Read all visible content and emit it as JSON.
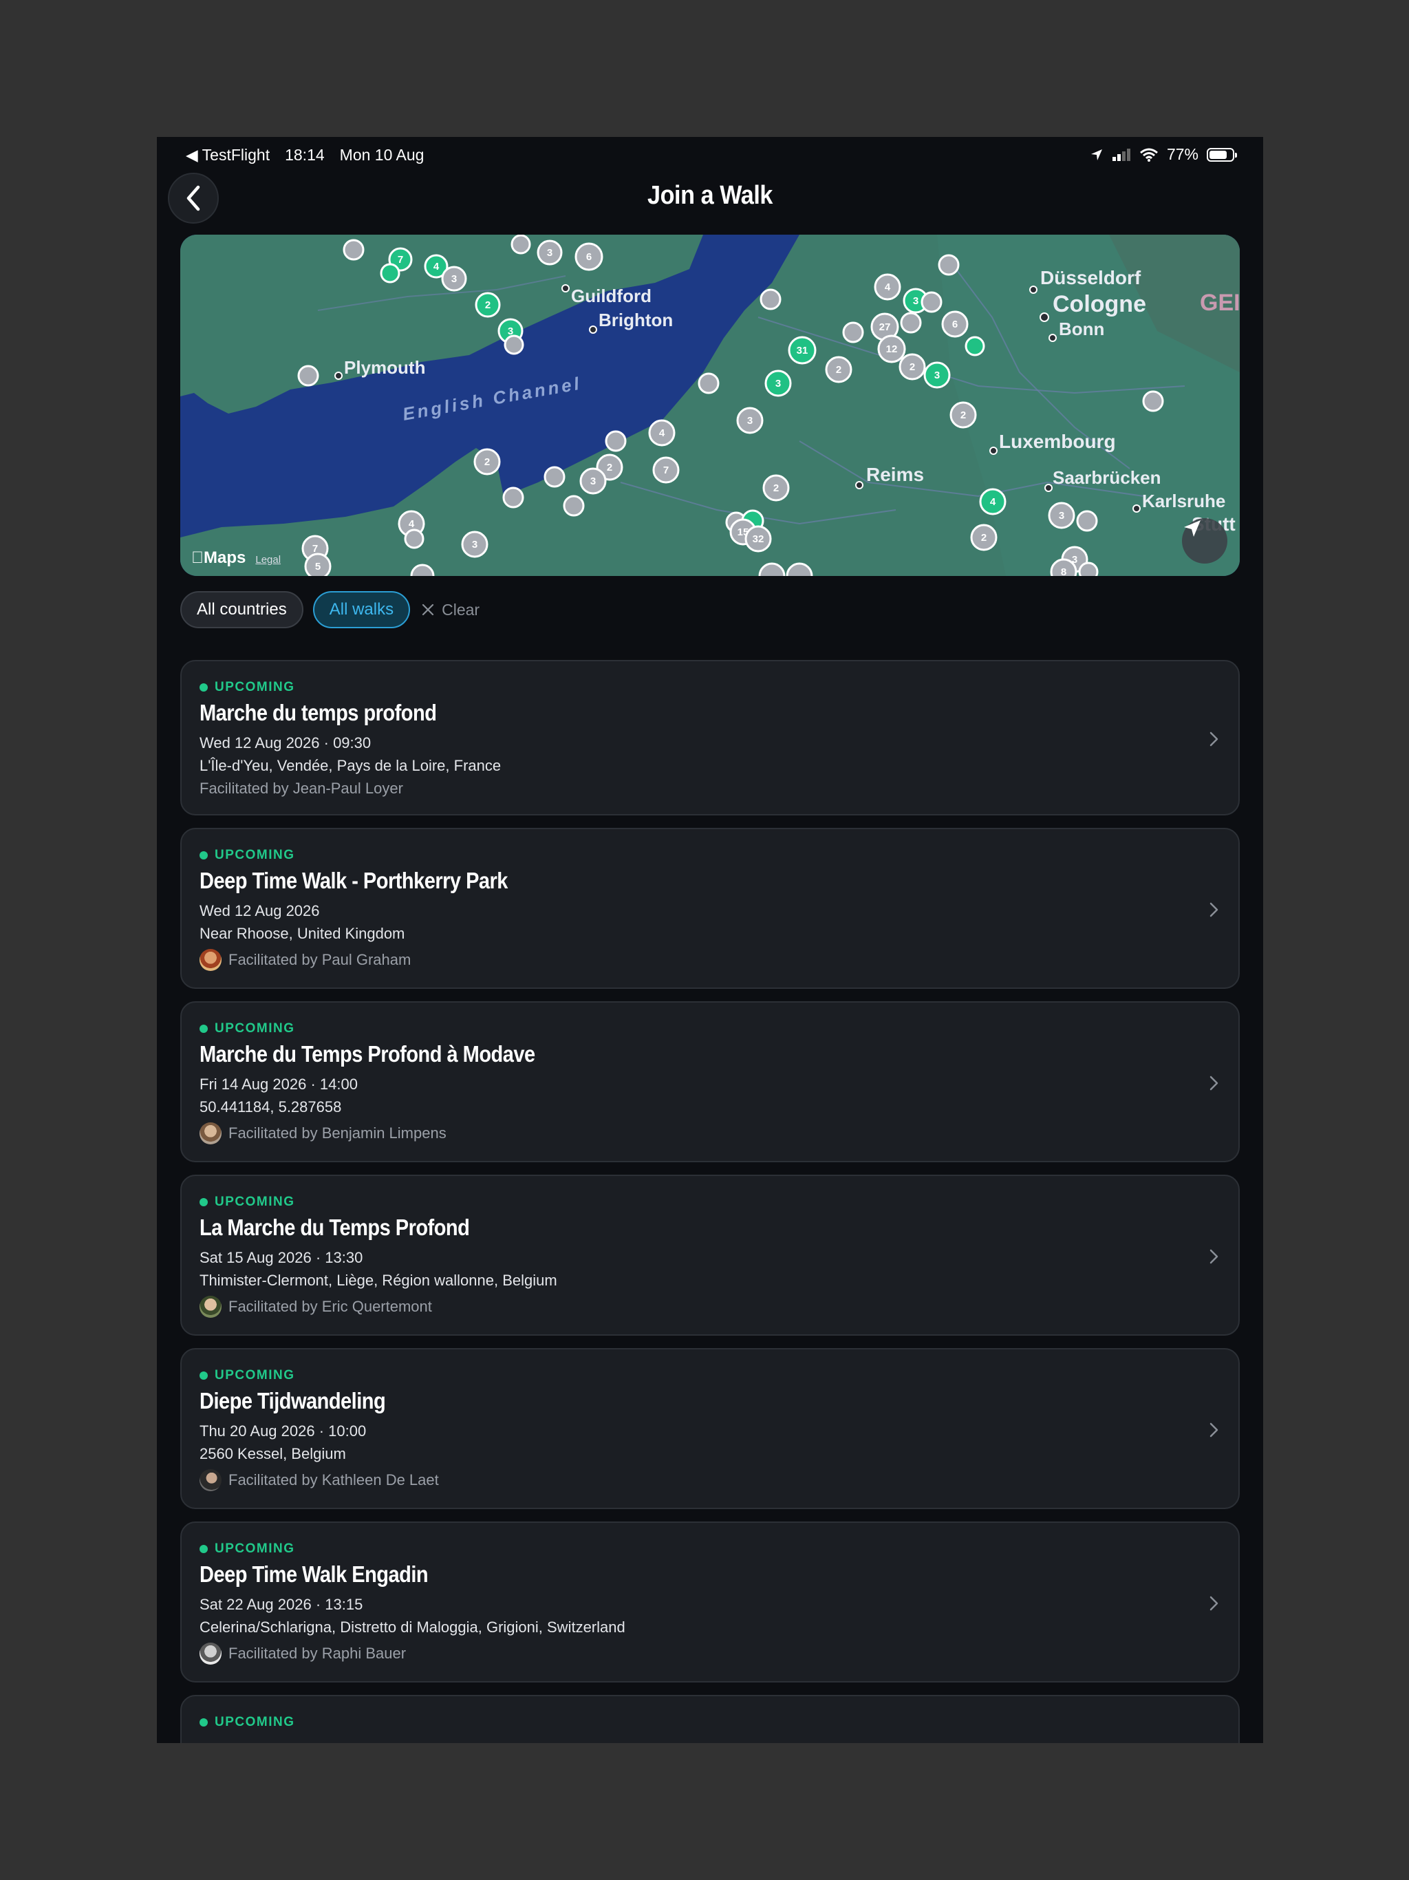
{
  "status_bar": {
    "app": "◀ TestFlight",
    "time": "18:14",
    "date": "Mon 10 Aug",
    "battery": "77%",
    "battery_level": 0.77
  },
  "header": {
    "title": "Join a Walk"
  },
  "map": {
    "labels": [
      "Guildford",
      "Brighton",
      "Plymouth",
      "English Channel",
      "Düsseldorf",
      "Cologne",
      "Bonn",
      "Luxembourg",
      "Reims",
      "Saarbrücken",
      "Karlsruhe",
      "Stutt",
      "GEI"
    ],
    "cluster_counts": [
      "7",
      "4",
      "3",
      "3",
      "6",
      "2",
      "3",
      "4",
      "3",
      "2",
      "27",
      "6",
      "12",
      "2",
      "3",
      "31",
      "3",
      "2",
      "2",
      "3",
      "4",
      "2",
      "2",
      "3",
      "7",
      "2",
      "4",
      "3",
      "4",
      "7",
      "5",
      "3",
      "15",
      "32",
      "2",
      "3",
      "3",
      "8"
    ],
    "attribution": "Maps",
    "legal": "Legal",
    "colors": {
      "gray_pin": "#a7abb2",
      "green_pin": "#20c184",
      "land": "#3f7d6d",
      "sea": "#1d3a86"
    }
  },
  "filters": {
    "country": "All countries",
    "walks": "All walks",
    "clear": "Clear"
  },
  "walks": [
    {
      "status": "UPCOMING",
      "title": "Marche du temps profond",
      "date": "Wed 12 Aug 2026 · 09:30",
      "location": "L'Île-d'Yeu, Vendée, Pays de la Loire, France",
      "facilitator": "Facilitated by Jean-Paul Loyer"
    },
    {
      "status": "UPCOMING",
      "title": "Deep Time Walk - Porthkerry Park",
      "date": "Wed 12 Aug 2026",
      "location": "Near Rhoose, United Kingdom",
      "facilitator": "Facilitated by Paul Graham"
    },
    {
      "status": "UPCOMING",
      "title": "Marche du Temps Profond à Modave",
      "date": "Fri 14 Aug 2026 · 14:00",
      "location": "50.441184, 5.287658",
      "facilitator": "Facilitated by Benjamin Limpens"
    },
    {
      "status": "UPCOMING",
      "title": "La Marche du Temps Profond",
      "date": "Sat 15 Aug 2026 · 13:30",
      "location": "Thimister-Clermont, Liège, Région wallonne, Belgium",
      "facilitator": "Facilitated by Eric Quertemont"
    },
    {
      "status": "UPCOMING",
      "title": "Diepe Tijdwandeling",
      "date": "Thu 20 Aug 2026 · 10:00",
      "location": "2560 Kessel, Belgium",
      "facilitator": "Facilitated by Kathleen De Laet"
    },
    {
      "status": "UPCOMING",
      "title": "Deep Time Walk Engadin",
      "date": "Sat 22 Aug 2026 · 13:15",
      "location": "Celerina/Schlarigna, Distretto di Maloggia, Grigioni, Switzerland",
      "facilitator": "Facilitated by Raphi Bauer"
    },
    {
      "status": "UPCOMING"
    }
  ]
}
